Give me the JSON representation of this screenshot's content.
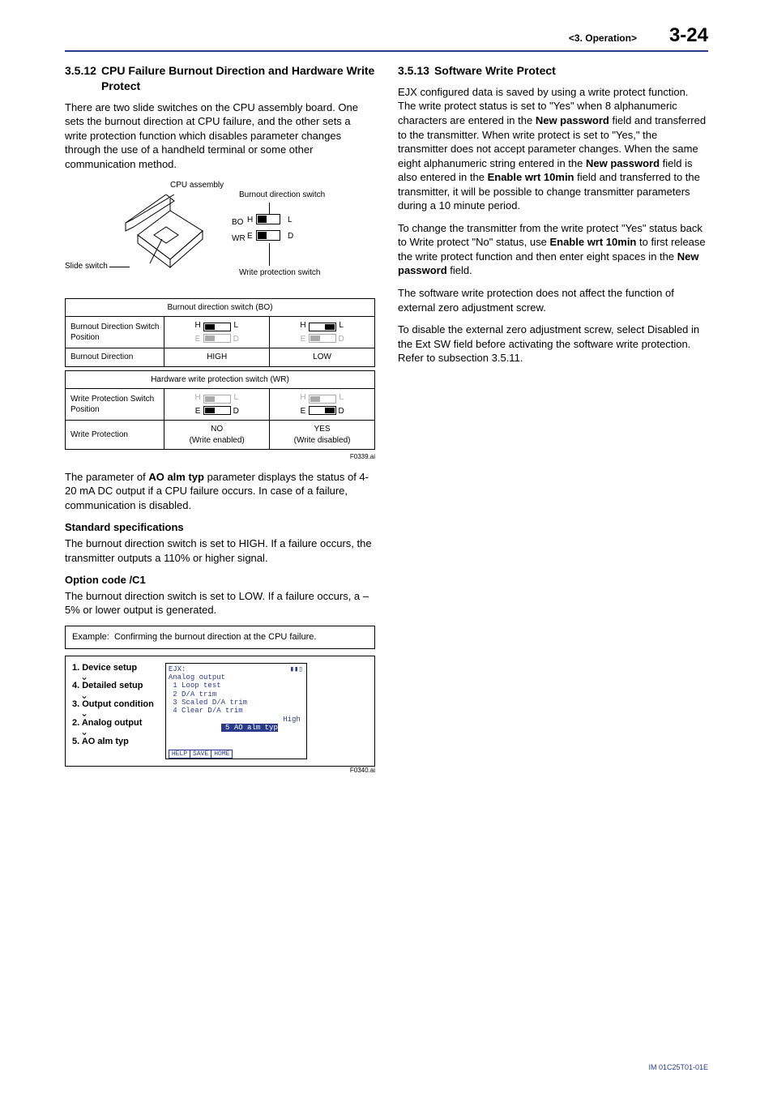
{
  "header": {
    "section": "<3. Operation>",
    "page": "3-24"
  },
  "left": {
    "h_num": "3.5.12",
    "h_title": "CPU Failure Burnout Direction and Hardware Write Protect",
    "p1": "There are two slide switches on the CPU assembly board. One sets the burnout direction at CPU failure, and the other sets a write protection function which disables parameter changes through the use of a handheld terminal or some other communication method.",
    "diagram": {
      "cpu_assembly": "CPU assembly",
      "burnout_switch": "Burnout direction switch",
      "write_switch": "Write protection switch",
      "slide_switch": "Slide switch",
      "bo": "BO",
      "wr": "WR",
      "H": "H",
      "L": "L",
      "E": "E",
      "D": "D"
    },
    "table_bo": {
      "title": "Burnout direction switch (BO)",
      "row1": "Burnout Direction Switch Position",
      "row2": "Burnout Direction",
      "high": "HIGH",
      "low": "LOW"
    },
    "table_wr": {
      "title": "Hardware write protection switch (WR)",
      "row1": "Write Protection Switch Position",
      "row2": "Write Protection",
      "no": "NO",
      "no_sub": "(Write enabled)",
      "yes": "YES",
      "yes_sub": "(Write disabled)"
    },
    "fignote1": "F0339.ai",
    "p2a": "The parameter of ",
    "p2b": "AO alm typ",
    "p2c": " parameter displays the status of 4-20 mA DC output if a CPU failure occurs. In case of a failure, communication is disabled.",
    "stdspec_h": "Standard specifications",
    "stdspec_p": "The burnout direction switch is set to HIGH. If a failure occurs, the transmitter outputs a 110% or higher signal.",
    "opt_h": "Option code /C1",
    "opt_p": "The burnout direction switch is set to LOW. If a failure occurs, a –5% or lower output is generated.",
    "example_label": "Example:",
    "example_text": "Confirming the burnout direction at the CPU failure.",
    "path": {
      "i1": "1. Device setup",
      "i2": "4. Detailed setup",
      "i3": "3. Output condition",
      "i4": "2. Analog output",
      "i5": "5. AO alm typ"
    },
    "lcd": {
      "l0": "EJX:",
      "l1": "Analog output",
      "l2": " 1 Loop test",
      "l3": " 2 D/A trim",
      "l4": " 3 Scaled D/A trim",
      "l5": " 4 Clear D/A trim",
      "l6a": " 5 ",
      "l6b": "AO alm typ",
      "l6r": "High",
      "b1": "HELP",
      "b2": "SAVE",
      "b3": "HOME"
    },
    "fignote2": "F0340.ai"
  },
  "right": {
    "h_num": "3.5.13",
    "h_title": "Software Write Protect",
    "p1a": "EJX configured data is saved by using a write protect function. The write protect status is set to \"Yes\" when 8 alphanumeric characters are entered in the ",
    "p1b": "New password",
    "p1c": " field and transferred to the transmitter. When write protect is set to \"Yes,\" the transmitter does not accept parameter changes. When the same eight alphanumeric string entered in the ",
    "p1d": "New password",
    "p1e": " field is also entered in the ",
    "p1f": "Enable wrt 10min",
    "p1g": " field and transferred to the transmitter, it will be possible to change transmitter parameters during a 10 minute period.",
    "p2a": "To change the transmitter from the write protect \"Yes\" status back to Write protect \"No\" status, use ",
    "p2b": "Enable wrt 10min",
    "p2c": " to first release the write protect function and then enter eight spaces in the ",
    "p2d": "New password",
    "p2e": " field.",
    "p3": "The software write protection does not affect the function of external zero adjustment screw.",
    "p4": "To disable the external zero adjustment screw, select Disabled in the Ext SW field before activating the software write protection. Refer to subsection 3.5.11."
  },
  "footer": "IM 01C25T01-01E"
}
